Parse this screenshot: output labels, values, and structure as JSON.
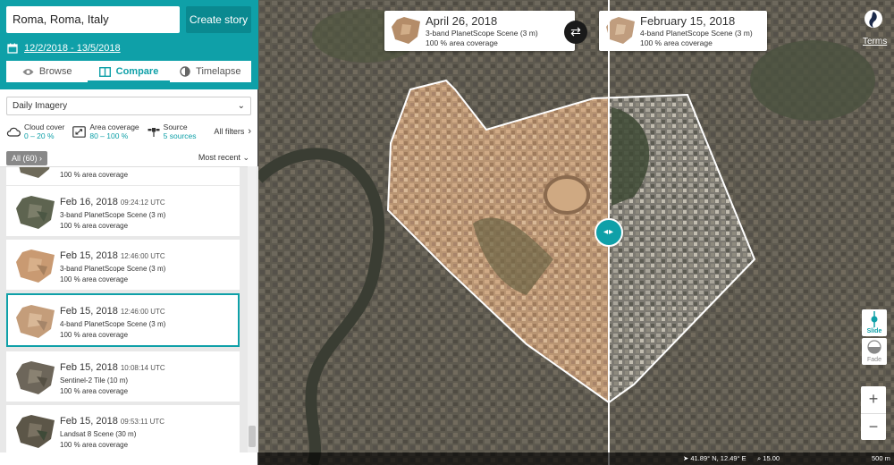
{
  "search": {
    "value": "Roma, Roma, Italy"
  },
  "create_story_label": "Create story",
  "date_range": "12/2/2018 - 13/5/2018",
  "tabs": [
    {
      "label": "Browse",
      "active": false
    },
    {
      "label": "Compare",
      "active": true
    },
    {
      "label": "Timelapse",
      "active": false
    }
  ],
  "imagery_type": "Daily Imagery",
  "filters": {
    "cloud": {
      "label": "Cloud cover",
      "value": "0 – 20 %"
    },
    "area": {
      "label": "Area coverage",
      "value": "80 – 100 %"
    },
    "source": {
      "label": "Source",
      "value": "5 sources"
    },
    "all_label": "All filters"
  },
  "list": {
    "all_label": "All (60)",
    "sort_label": "Most recent",
    "partial_coverage": "100 % area coverage",
    "items": [
      {
        "date": "Feb 16, 2018",
        "time": "09:24:12 UTC",
        "source": "3-band PlanetScope Scene (3 m)",
        "coverage": "100 % area coverage",
        "selected": false
      },
      {
        "date": "Feb 15, 2018",
        "time": "12:46:00 UTC",
        "source": "3-band PlanetScope Scene (3 m)",
        "coverage": "100 % area coverage",
        "selected": false
      },
      {
        "date": "Feb 15, 2018",
        "time": "12:46:00 UTC",
        "source": "4-band PlanetScope Scene (3 m)",
        "coverage": "100 % area coverage",
        "selected": true
      },
      {
        "date": "Feb 15, 2018",
        "time": "10:08:14 UTC",
        "source": "Sentinel-2 Tile (10 m)",
        "coverage": "100 % area coverage",
        "selected": false
      },
      {
        "date": "Feb 15, 2018",
        "time": "09:53:11 UTC",
        "source": "Landsat 8 Scene (30 m)",
        "coverage": "100 % area coverage",
        "selected": false
      }
    ]
  },
  "compare": {
    "left": {
      "date": "April 26, 2018",
      "source": "3-band PlanetScope Scene (3 m)",
      "coverage": "100 % area coverage"
    },
    "right": {
      "date": "February 15, 2018",
      "source": "4-band PlanetScope Scene (3 m)",
      "coverage": "100 % area coverage"
    }
  },
  "terms_label": "Terms",
  "modes": {
    "slide": "Slide",
    "fade": "Fade"
  },
  "status": {
    "coords": "41.89° N, 12.49° E",
    "zoom": "15.00",
    "scale": "500 m"
  },
  "colors": {
    "accent": "#0fa0a8",
    "accent_dark": "#0a8990"
  },
  "icons": [
    "calendar-icon",
    "eye-icon",
    "compare-icon",
    "timelapse-icon",
    "cloud-icon",
    "area-icon",
    "satellite-icon",
    "swap-icon",
    "location-arrow-icon",
    "magnifier-icon"
  ]
}
